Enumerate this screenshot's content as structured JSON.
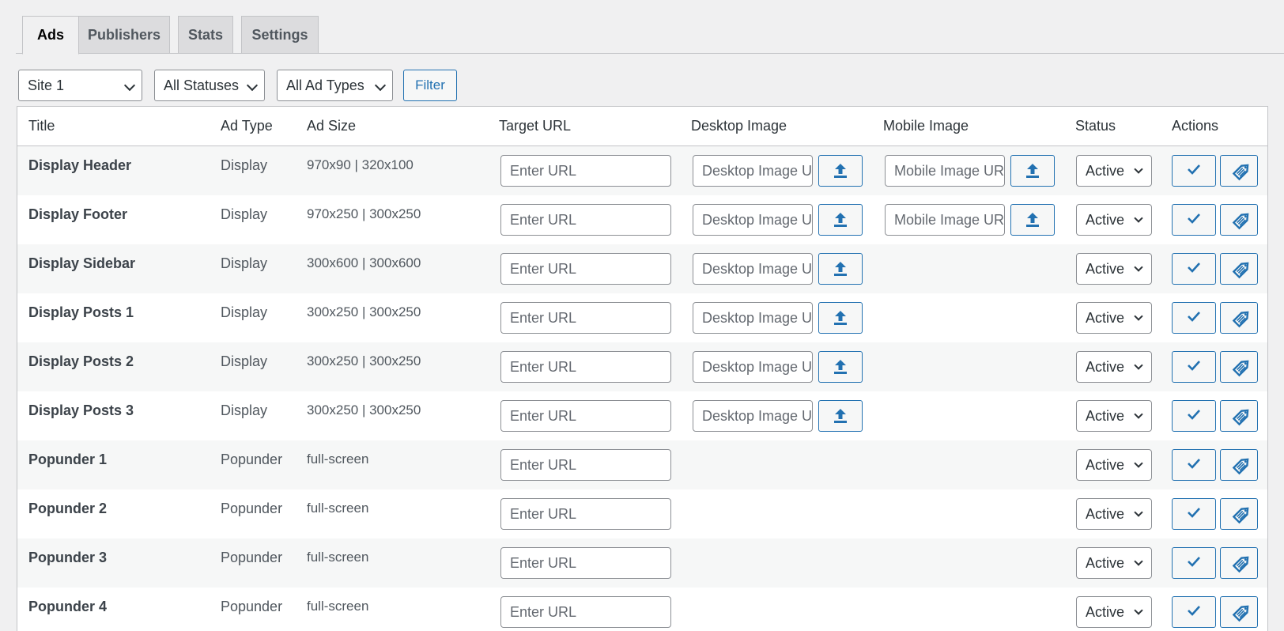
{
  "tabs": [
    {
      "label": "Ads",
      "active": true
    },
    {
      "label": "Publishers",
      "active": false
    },
    {
      "label": "Stats",
      "active": false
    },
    {
      "label": "Settings",
      "active": false
    }
  ],
  "filters": {
    "site": "Site 1",
    "status": "All Statuses",
    "ad_type": "All Ad Types",
    "filter_button": "Filter"
  },
  "table": {
    "columns": [
      "Title",
      "Ad Type",
      "Ad Size",
      "Target URL",
      "Desktop Image",
      "Mobile Image",
      "Status",
      "Actions"
    ],
    "url_placeholder": "Enter URL",
    "desktop_placeholder": "Desktop Image URL",
    "mobile_placeholder": "Mobile Image URL",
    "status_value": "Active",
    "rows": [
      {
        "title": "Display Header",
        "type": "Display",
        "size": "970x90 | 320x100",
        "desktop": true,
        "mobile": true
      },
      {
        "title": "Display Footer",
        "type": "Display",
        "size": "970x250 | 300x250",
        "desktop": true,
        "mobile": true
      },
      {
        "title": "Display Sidebar",
        "type": "Display",
        "size": "300x600 | 300x600",
        "desktop": true,
        "mobile": false
      },
      {
        "title": "Display Posts 1",
        "type": "Display",
        "size": "300x250 | 300x250",
        "desktop": true,
        "mobile": false
      },
      {
        "title": "Display Posts 2",
        "type": "Display",
        "size": "300x250 | 300x250",
        "desktop": true,
        "mobile": false
      },
      {
        "title": "Display Posts 3",
        "type": "Display",
        "size": "300x250 | 300x250",
        "desktop": true,
        "mobile": false
      },
      {
        "title": "Popunder 1",
        "type": "Popunder",
        "size": "full-screen",
        "desktop": false,
        "mobile": false
      },
      {
        "title": "Popunder 2",
        "type": "Popunder",
        "size": "full-screen",
        "desktop": false,
        "mobile": false
      },
      {
        "title": "Popunder 3",
        "type": "Popunder",
        "size": "full-screen",
        "desktop": false,
        "mobile": false
      },
      {
        "title": "Popunder 4",
        "type": "Popunder",
        "size": "full-screen",
        "desktop": false,
        "mobile": false
      }
    ]
  },
  "icons": {
    "upload": "upload-icon",
    "save": "checkmark-icon",
    "tag": "tag-icon"
  },
  "colors": {
    "accent": "#2271b1",
    "background": "#f0f0f1"
  }
}
